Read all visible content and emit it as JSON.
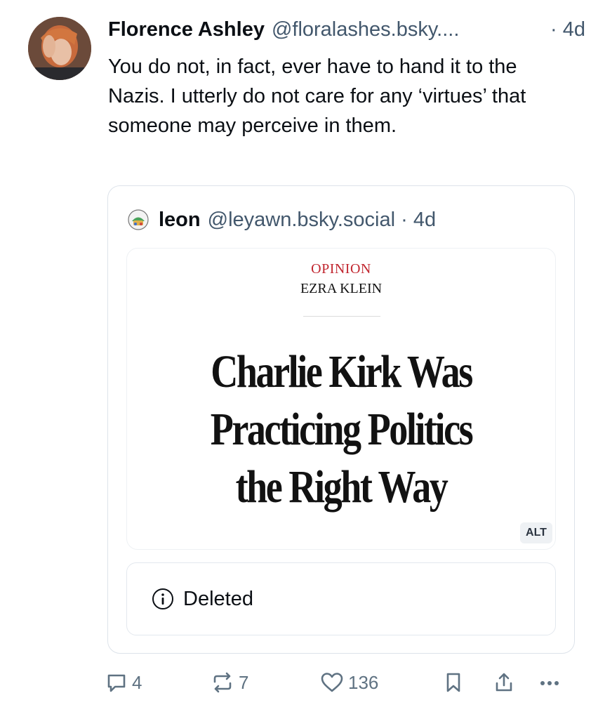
{
  "post": {
    "author_name": "Florence Ashley",
    "author_handle": "@floralashes.bsky....",
    "time": "· 4d",
    "text": "You do not, in fact, ever have to hand it to the Nazis. I utterly do not care for any ‘virtues’ that someone may perceive in them."
  },
  "quote": {
    "author_name": "leon",
    "author_handle": "@leyawn.bsky.social · 4d",
    "image": {
      "section": "OPINION",
      "byline": "EZRA KLEIN",
      "headline_lines": [
        "Charlie Kirk Was",
        "Practicing Politics",
        "the Right Way"
      ],
      "alt_label": "ALT"
    },
    "deleted_label": "Deleted"
  },
  "actions": {
    "replies": "4",
    "reposts": "7",
    "likes": "136"
  },
  "colors": {
    "secondary_text": "#42576c",
    "border": "#dde3ea",
    "opinion_red": "#c1262f",
    "icon_gray": "#5f7282"
  }
}
